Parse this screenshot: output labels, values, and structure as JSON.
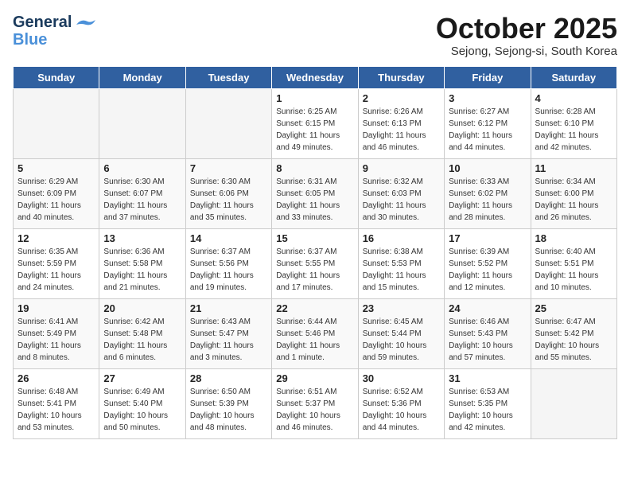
{
  "header": {
    "logo_line1": "General",
    "logo_line2": "Blue",
    "month": "October 2025",
    "location": "Sejong, Sejong-si, South Korea"
  },
  "weekdays": [
    "Sunday",
    "Monday",
    "Tuesday",
    "Wednesday",
    "Thursday",
    "Friday",
    "Saturday"
  ],
  "weeks": [
    [
      {
        "day": "",
        "info": ""
      },
      {
        "day": "",
        "info": ""
      },
      {
        "day": "",
        "info": ""
      },
      {
        "day": "1",
        "info": "Sunrise: 6:25 AM\nSunset: 6:15 PM\nDaylight: 11 hours\nand 49 minutes."
      },
      {
        "day": "2",
        "info": "Sunrise: 6:26 AM\nSunset: 6:13 PM\nDaylight: 11 hours\nand 46 minutes."
      },
      {
        "day": "3",
        "info": "Sunrise: 6:27 AM\nSunset: 6:12 PM\nDaylight: 11 hours\nand 44 minutes."
      },
      {
        "day": "4",
        "info": "Sunrise: 6:28 AM\nSunset: 6:10 PM\nDaylight: 11 hours\nand 42 minutes."
      }
    ],
    [
      {
        "day": "5",
        "info": "Sunrise: 6:29 AM\nSunset: 6:09 PM\nDaylight: 11 hours\nand 40 minutes."
      },
      {
        "day": "6",
        "info": "Sunrise: 6:30 AM\nSunset: 6:07 PM\nDaylight: 11 hours\nand 37 minutes."
      },
      {
        "day": "7",
        "info": "Sunrise: 6:30 AM\nSunset: 6:06 PM\nDaylight: 11 hours\nand 35 minutes."
      },
      {
        "day": "8",
        "info": "Sunrise: 6:31 AM\nSunset: 6:05 PM\nDaylight: 11 hours\nand 33 minutes."
      },
      {
        "day": "9",
        "info": "Sunrise: 6:32 AM\nSunset: 6:03 PM\nDaylight: 11 hours\nand 30 minutes."
      },
      {
        "day": "10",
        "info": "Sunrise: 6:33 AM\nSunset: 6:02 PM\nDaylight: 11 hours\nand 28 minutes."
      },
      {
        "day": "11",
        "info": "Sunrise: 6:34 AM\nSunset: 6:00 PM\nDaylight: 11 hours\nand 26 minutes."
      }
    ],
    [
      {
        "day": "12",
        "info": "Sunrise: 6:35 AM\nSunset: 5:59 PM\nDaylight: 11 hours\nand 24 minutes."
      },
      {
        "day": "13",
        "info": "Sunrise: 6:36 AM\nSunset: 5:58 PM\nDaylight: 11 hours\nand 21 minutes."
      },
      {
        "day": "14",
        "info": "Sunrise: 6:37 AM\nSunset: 5:56 PM\nDaylight: 11 hours\nand 19 minutes."
      },
      {
        "day": "15",
        "info": "Sunrise: 6:37 AM\nSunset: 5:55 PM\nDaylight: 11 hours\nand 17 minutes."
      },
      {
        "day": "16",
        "info": "Sunrise: 6:38 AM\nSunset: 5:53 PM\nDaylight: 11 hours\nand 15 minutes."
      },
      {
        "day": "17",
        "info": "Sunrise: 6:39 AM\nSunset: 5:52 PM\nDaylight: 11 hours\nand 12 minutes."
      },
      {
        "day": "18",
        "info": "Sunrise: 6:40 AM\nSunset: 5:51 PM\nDaylight: 11 hours\nand 10 minutes."
      }
    ],
    [
      {
        "day": "19",
        "info": "Sunrise: 6:41 AM\nSunset: 5:49 PM\nDaylight: 11 hours\nand 8 minutes."
      },
      {
        "day": "20",
        "info": "Sunrise: 6:42 AM\nSunset: 5:48 PM\nDaylight: 11 hours\nand 6 minutes."
      },
      {
        "day": "21",
        "info": "Sunrise: 6:43 AM\nSunset: 5:47 PM\nDaylight: 11 hours\nand 3 minutes."
      },
      {
        "day": "22",
        "info": "Sunrise: 6:44 AM\nSunset: 5:46 PM\nDaylight: 11 hours\nand 1 minute."
      },
      {
        "day": "23",
        "info": "Sunrise: 6:45 AM\nSunset: 5:44 PM\nDaylight: 10 hours\nand 59 minutes."
      },
      {
        "day": "24",
        "info": "Sunrise: 6:46 AM\nSunset: 5:43 PM\nDaylight: 10 hours\nand 57 minutes."
      },
      {
        "day": "25",
        "info": "Sunrise: 6:47 AM\nSunset: 5:42 PM\nDaylight: 10 hours\nand 55 minutes."
      }
    ],
    [
      {
        "day": "26",
        "info": "Sunrise: 6:48 AM\nSunset: 5:41 PM\nDaylight: 10 hours\nand 53 minutes."
      },
      {
        "day": "27",
        "info": "Sunrise: 6:49 AM\nSunset: 5:40 PM\nDaylight: 10 hours\nand 50 minutes."
      },
      {
        "day": "28",
        "info": "Sunrise: 6:50 AM\nSunset: 5:39 PM\nDaylight: 10 hours\nand 48 minutes."
      },
      {
        "day": "29",
        "info": "Sunrise: 6:51 AM\nSunset: 5:37 PM\nDaylight: 10 hours\nand 46 minutes."
      },
      {
        "day": "30",
        "info": "Sunrise: 6:52 AM\nSunset: 5:36 PM\nDaylight: 10 hours\nand 44 minutes."
      },
      {
        "day": "31",
        "info": "Sunrise: 6:53 AM\nSunset: 5:35 PM\nDaylight: 10 hours\nand 42 minutes."
      },
      {
        "day": "",
        "info": ""
      }
    ]
  ]
}
